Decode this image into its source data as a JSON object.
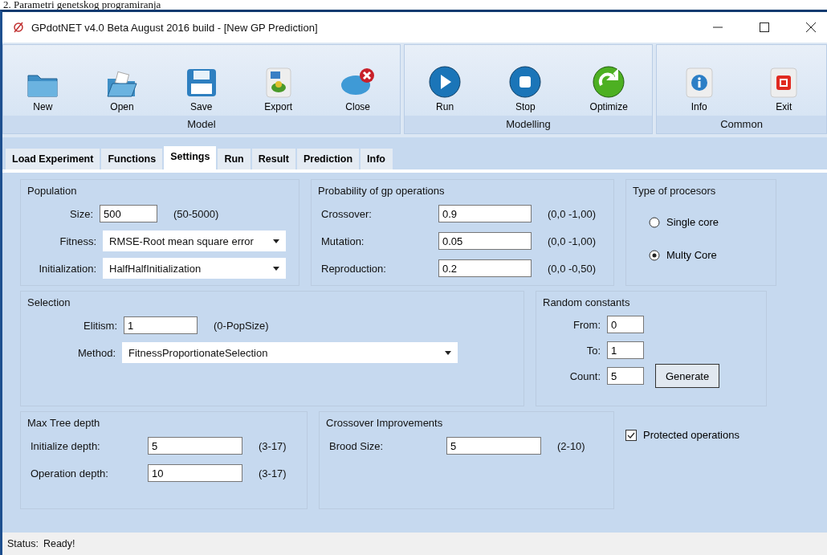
{
  "caption": "2. Parametri genetskog programiranja",
  "window": {
    "title": "GPdotNET v4.0 Beta August 2016 build - [New GP Prediction]"
  },
  "ribbon": [
    {
      "label": "Model",
      "buttons": [
        "New",
        "Open",
        "Save",
        "Export",
        "Close"
      ]
    },
    {
      "label": "Modelling",
      "buttons": [
        "Run",
        "Stop",
        "Optimize"
      ]
    },
    {
      "label": "Common",
      "buttons": [
        "Info",
        "Exit"
      ]
    }
  ],
  "tabs": [
    {
      "label": "Load Experiment",
      "selected": false
    },
    {
      "label": "Functions",
      "selected": false
    },
    {
      "label": "Settings",
      "selected": true
    },
    {
      "label": "Run",
      "selected": false
    },
    {
      "label": "Result",
      "selected": false
    },
    {
      "label": "Prediction",
      "selected": false
    },
    {
      "label": "Info",
      "selected": false
    }
  ],
  "population": {
    "title": "Population",
    "size": {
      "label": "Size:",
      "value": "500",
      "range": "(50-5000)"
    },
    "fitness": {
      "label": "Fitness:",
      "value": "RMSE-Root mean square error"
    },
    "initialization": {
      "label": "Initialization:",
      "value": "HalfHalfInitialization"
    }
  },
  "probability": {
    "title": "Probability of gp operations",
    "rows": [
      {
        "label": "Crossover:",
        "value": "0.9",
        "range": "(0,0 -1,00)"
      },
      {
        "label": "Mutation:",
        "value": "0.05",
        "range": "(0,0 -1,00)"
      },
      {
        "label": "Reproduction:",
        "value": "0.2",
        "range": "(0,0 -0,50)"
      }
    ]
  },
  "processors": {
    "title": "Type of procesors",
    "options": [
      {
        "label": "Single core",
        "selected": false
      },
      {
        "label": "Multy Core",
        "selected": true
      }
    ]
  },
  "selection": {
    "title": "Selection",
    "elitism": {
      "label": "Elitism:",
      "value": "1",
      "range": "(0-PopSize)"
    },
    "method": {
      "label": "Method:",
      "value": "FitnessProportionateSelection"
    }
  },
  "random_constants": {
    "title": "Random constants",
    "rows": [
      {
        "label": "From:",
        "value": "0"
      },
      {
        "label": "To:",
        "value": "1"
      },
      {
        "label": "Count:",
        "value": "5"
      }
    ],
    "button": "Generate"
  },
  "max_tree_depth": {
    "title": "Max Tree depth",
    "rows": [
      {
        "label": "Initialize depth:",
        "value": "5",
        "range": "(3-17)"
      },
      {
        "label": "Operation depth:",
        "value": "10",
        "range": "(3-17)"
      }
    ]
  },
  "crossover_improvements": {
    "title": "Crossover Improvements",
    "rows": [
      {
        "label": "Brood Size:",
        "value": "5",
        "range": "(2-10)"
      }
    ]
  },
  "protected_operations": {
    "label": "Protected operations",
    "checked": true
  },
  "status_bar": {
    "label": "Status:",
    "value": "Ready!"
  }
}
